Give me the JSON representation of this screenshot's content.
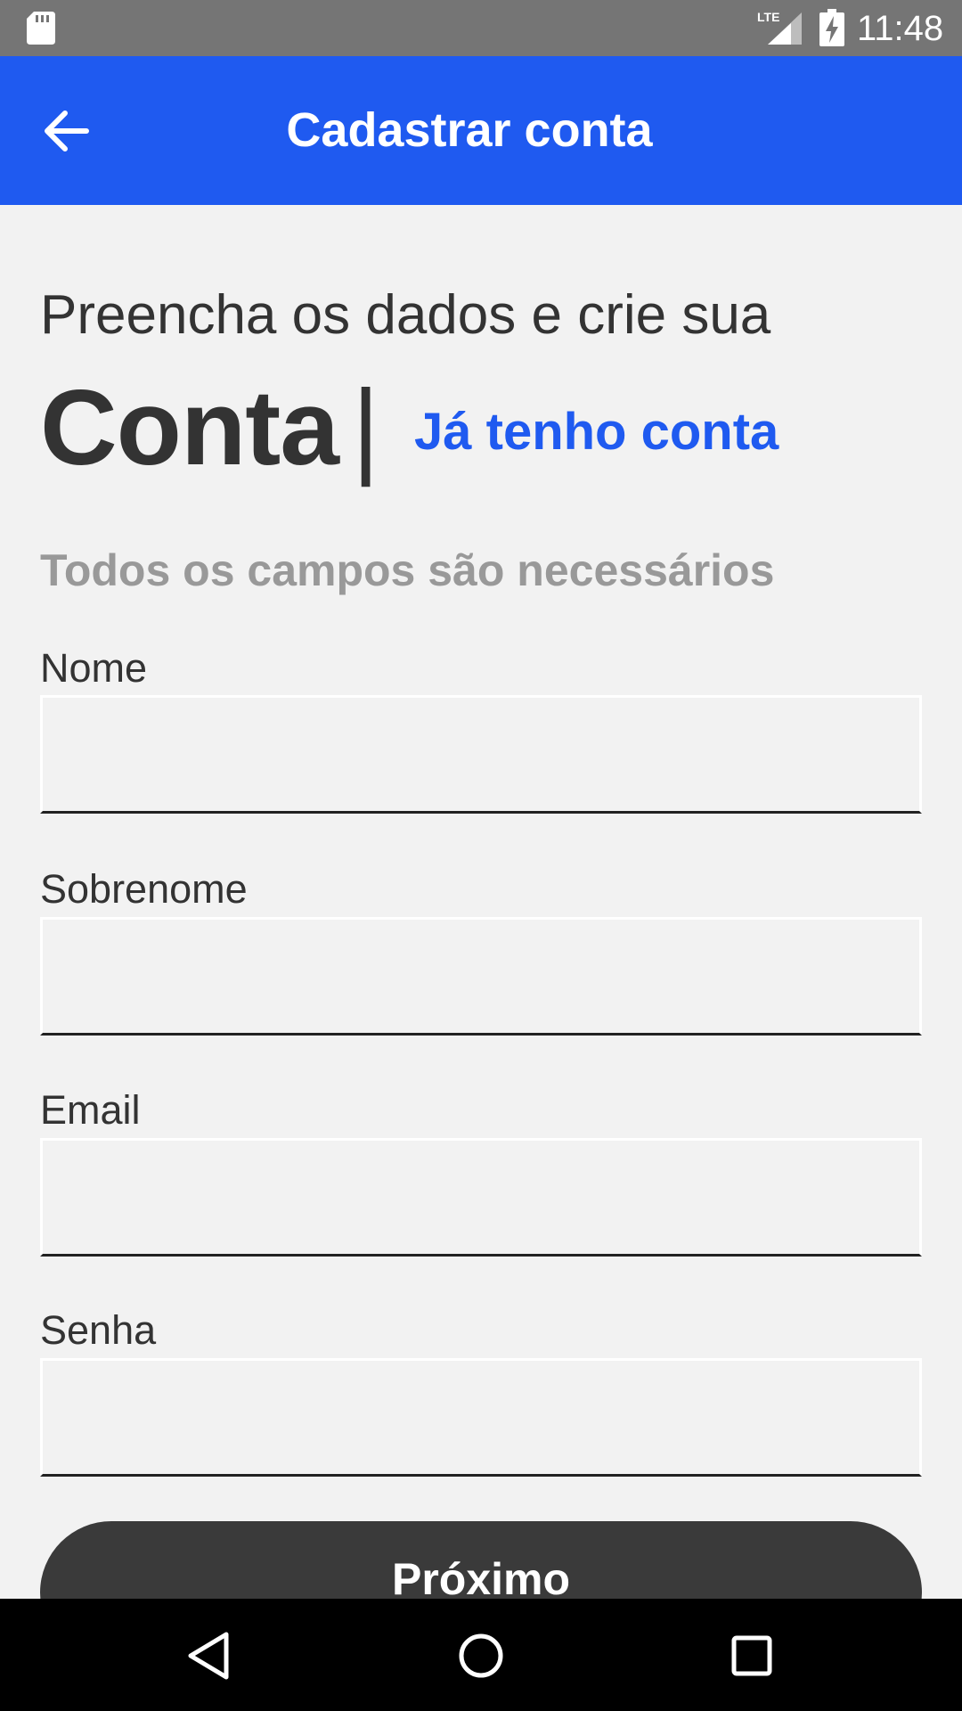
{
  "status_bar": {
    "time": "11:48",
    "network": "LTE",
    "icons": [
      "sd-card-icon",
      "lte-signal-icon",
      "battery-charging-icon"
    ]
  },
  "app_bar": {
    "title": "Cadastrar conta",
    "back_icon": "arrow-back-icon",
    "background": "#1f5af0"
  },
  "header": {
    "intro": "Preencha os dados e crie sua",
    "title": "Conta",
    "separator": "|",
    "login_link": "Já tenho conta"
  },
  "form": {
    "required_note": "Todos os campos são necessários",
    "fields": [
      {
        "label": "Nome",
        "value": ""
      },
      {
        "label": "Sobrenome",
        "value": ""
      },
      {
        "label": "Email",
        "value": ""
      },
      {
        "label": "Senha",
        "value": ""
      }
    ],
    "submit_label": "Próximo"
  },
  "nav_bar": {
    "icons": [
      "nav-back-icon",
      "nav-home-icon",
      "nav-recents-icon"
    ]
  },
  "colors": {
    "accent": "#1f5af0",
    "text": "#333333",
    "muted": "#999999",
    "button": "#3a3a3a"
  }
}
